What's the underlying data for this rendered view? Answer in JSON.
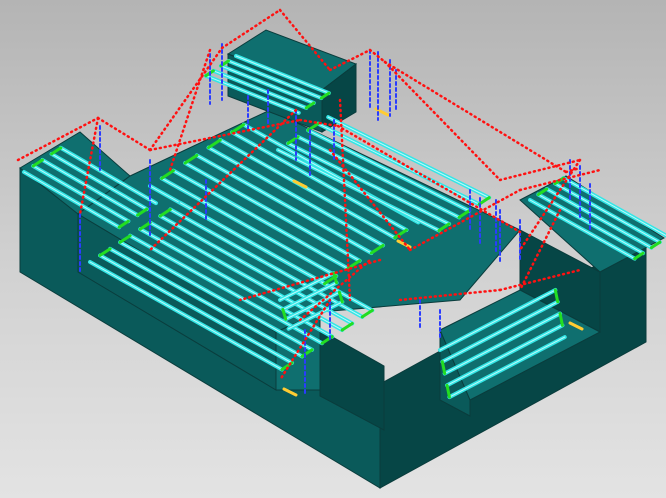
{
  "viewport": {
    "view": "isometric",
    "background": [
      "#b4b4b4",
      "#e3e3e3"
    ]
  },
  "part": {
    "face_top_color": "#0f6f6f",
    "face_left_color": "#0a5a5a",
    "face_right_color": "#064646",
    "edge_color": "#0a3c3c"
  },
  "toolpath": {
    "cut_color": "#33e6e6",
    "engage_color": "#22dd22",
    "retract_color": "#ffcc33",
    "plunge_color": "#2a3cff",
    "rapid_color": "#ff1111",
    "rapid_style": "dotted",
    "regions": [
      "top-left-ledge",
      "top-back-block",
      "upper-pocket",
      "center-floor",
      "right-shelf",
      "front-step"
    ]
  }
}
